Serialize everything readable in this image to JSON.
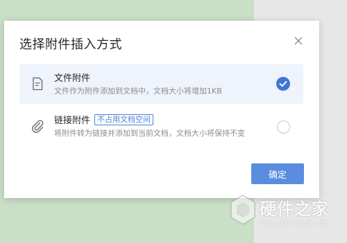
{
  "dialog": {
    "title": "选择附件插入方式",
    "close_icon": "close-icon",
    "options": [
      {
        "title": "文件附件",
        "description": "文件作为附件添加到文档中，文档大小将增加1KB",
        "icon": "file-icon",
        "selected": true
      },
      {
        "title": "链接附件",
        "tag": "不占用文档空间",
        "description": "将附件转为链接并添加到当前文档，文档大小将保持不变",
        "icon": "paperclip-icon",
        "selected": false
      }
    ],
    "confirm_label": "确定"
  },
  "watermark": {
    "text": "硬件之家",
    "subtext": "YING JIAN ZHI JIA.COM"
  },
  "colors": {
    "accent": "#3e76d6",
    "button": "#5a8de0",
    "selected_bg": "#eef3fc",
    "left_bg": "#c9dfc6",
    "right_bg": "#e7e7e7"
  }
}
